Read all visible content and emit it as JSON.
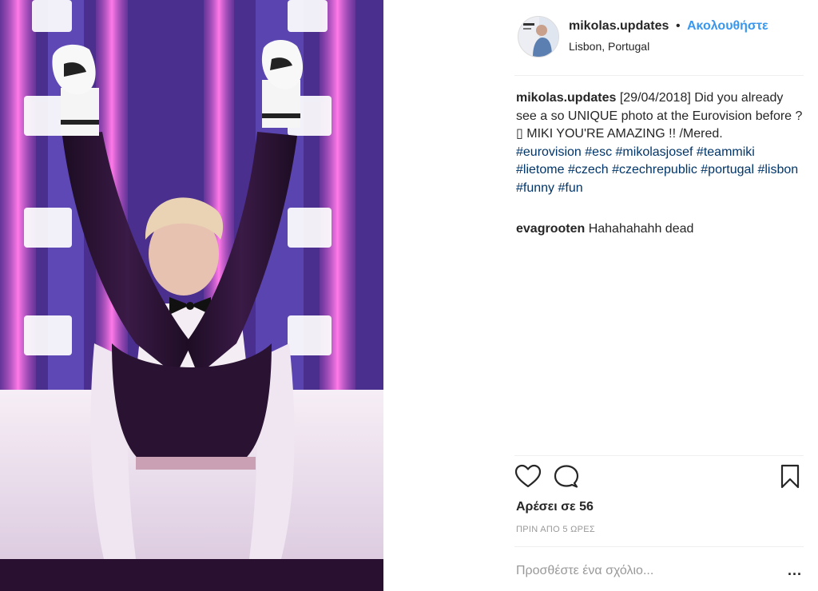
{
  "post": {
    "username": "mikolas.updates",
    "separator": "•",
    "follow_label": "Ακολουθήστε",
    "location": "Lisbon, Portugal"
  },
  "caption": {
    "username": "mikolas.updates",
    "text": " [29/04/2018] Did you already see a so UNIQUE photo at the Eurovision before ? ▯ MIKI YOU'RE AMAZING !! /Mered.",
    "hashtags": [
      "#eurovision",
      "#esc",
      "#mikolasjosef",
      "#teammiki",
      "#lietome",
      "#czech",
      "#czechrepublic",
      "#portugal",
      "#lisbon",
      "#funny",
      "#fun"
    ]
  },
  "comments": [
    {
      "username": "evagrooten",
      "text": "Hahahahahh dead"
    }
  ],
  "actions": {
    "like_icon": "heart-icon",
    "comment_icon": "comment-icon",
    "save_icon": "bookmark-icon"
  },
  "likes_text": "Αρέσει σε 56",
  "time_text": "ΠΡΙΝ ΑΠΟ 5 ΩΡΕΣ",
  "add_comment_placeholder": "Προσθέστε ένα σχόλιο...",
  "more_label": "...",
  "colors": {
    "link_blue": "#3897f0",
    "hashtag": "#003569",
    "muted": "#999999",
    "text": "#262626"
  }
}
